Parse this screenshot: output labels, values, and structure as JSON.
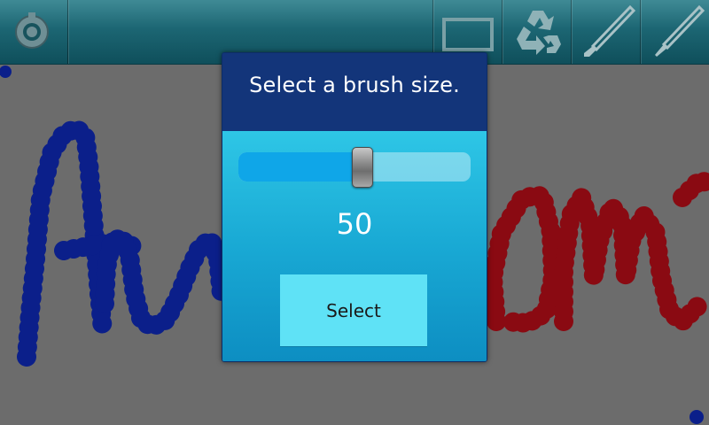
{
  "toolbar": {
    "items": [
      {
        "icon": "settings-gear-icon"
      },
      {
        "icon": "frame-icon"
      },
      {
        "icon": "recycle-icon"
      },
      {
        "icon": "brush-icon"
      },
      {
        "icon": "pen-icon"
      }
    ]
  },
  "dialog": {
    "title": "Select a brush size.",
    "slider": {
      "value": "50",
      "min": 0,
      "max": 100,
      "fraction": 0.5
    },
    "select_label": "Select"
  },
  "canvas": {
    "stroke_colors": [
      "#0b1f8a",
      "#8a0a12"
    ]
  }
}
